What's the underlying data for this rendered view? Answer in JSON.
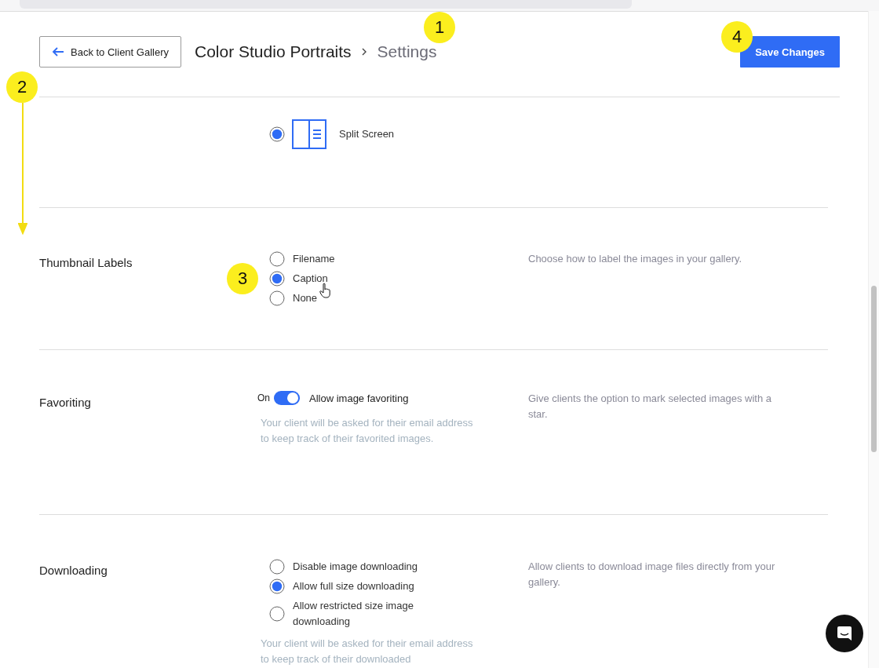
{
  "header": {
    "back_button": "Back to Client Gallery",
    "breadcrumb": [
      "Color Studio Portraits",
      "Settings"
    ],
    "save_button": "Save Changes"
  },
  "sections": [
    {
      "kind": "layout",
      "options": [
        {
          "label": "Split Screen",
          "selected": true
        }
      ]
    },
    {
      "kind": "radio",
      "title": "Thumbnail Labels",
      "options": [
        {
          "label": "Filename",
          "selected": false
        },
        {
          "label": "Caption",
          "selected": true
        },
        {
          "label": "None",
          "selected": false
        }
      ],
      "description": "Choose how to label the images in your gallery."
    },
    {
      "kind": "toggle",
      "title": "Favoriting",
      "toggle_text": "On",
      "on": true,
      "toggle_label": "Allow image favoriting",
      "note": "Your client will be asked for their email address to keep track of their favorited images.",
      "description": "Give clients the option to mark selected images with a star."
    },
    {
      "kind": "radio",
      "title": "Downloading",
      "options": [
        {
          "label": "Disable image downloading",
          "selected": false
        },
        {
          "label": "Allow full size downloading",
          "selected": true
        },
        {
          "label": "Allow restricted size image downloading",
          "selected": false
        }
      ],
      "note": "Your client will be asked for their email address to keep track of their downloaded",
      "description": "Allow clients to download image files directly from your gallery."
    }
  ],
  "annotations": [
    {
      "label": "1"
    },
    {
      "label": "2"
    },
    {
      "label": "3"
    },
    {
      "label": "4"
    }
  ]
}
